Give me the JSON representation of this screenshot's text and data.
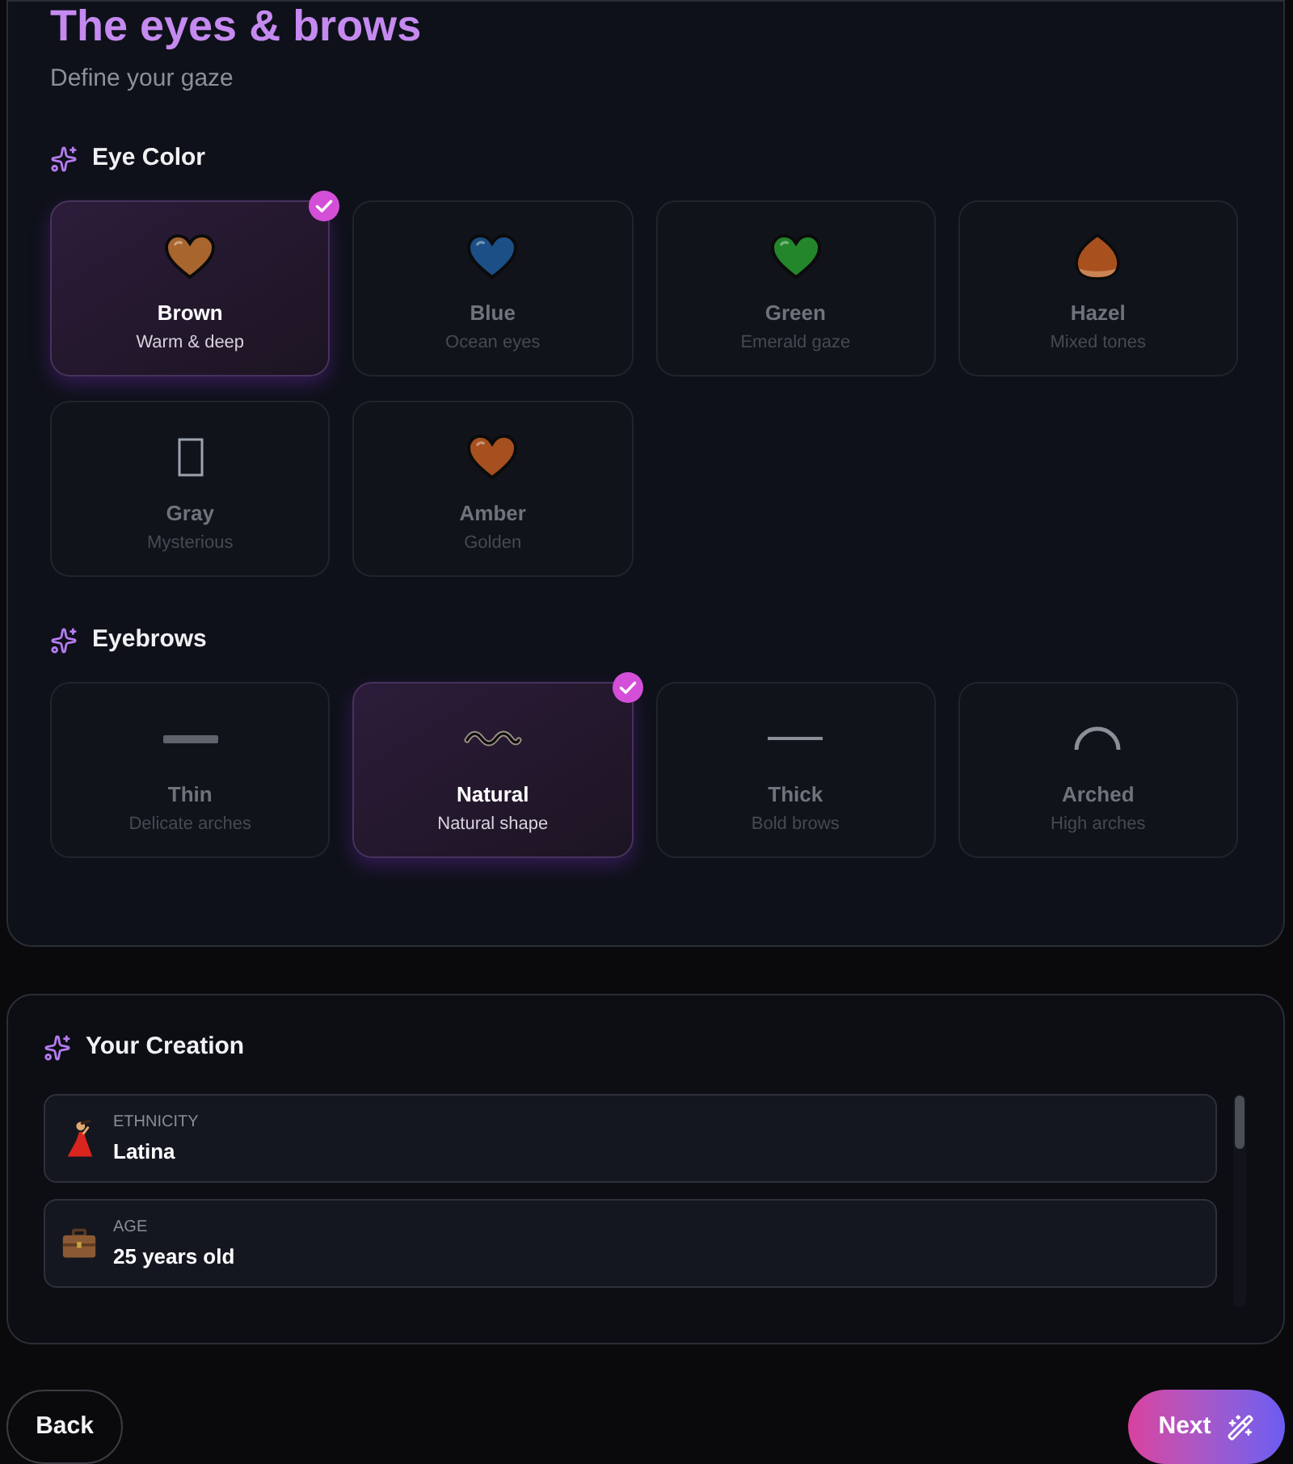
{
  "header": {
    "title": "The eyes & brows",
    "subtitle": "Define your gaze"
  },
  "sections": [
    {
      "heading": "Eye Color",
      "options": [
        {
          "kind": "heart",
          "label": "Brown",
          "caption": "Warm & deep",
          "color": "#a8652e",
          "selected": true
        },
        {
          "kind": "heart",
          "label": "Blue",
          "caption": "Ocean eyes",
          "color": "#1b4f86",
          "selected": false
        },
        {
          "kind": "heart",
          "label": "Green",
          "caption": "Emerald gaze",
          "color": "#23862a",
          "selected": false
        },
        {
          "kind": "chestnut",
          "label": "Hazel",
          "caption": "Mixed tones",
          "color": "#a9501f",
          "selected": false
        },
        {
          "kind": "missing-glyph",
          "label": "Gray",
          "caption": "Mysterious",
          "color": "#9ca3af",
          "selected": false
        },
        {
          "kind": "heart",
          "label": "Amber",
          "caption": "Golden",
          "color": "#a64f1f",
          "selected": false
        }
      ]
    },
    {
      "heading": "Eyebrows",
      "options": [
        {
          "kind": "bar",
          "label": "Thin",
          "caption": "Delicate arches",
          "selected": false
        },
        {
          "kind": "wave",
          "label": "Natural",
          "caption": "Natural shape",
          "selected": true
        },
        {
          "kind": "line",
          "label": "Thick",
          "caption": "Bold brows",
          "selected": false
        },
        {
          "kind": "arc",
          "label": "Arched",
          "caption": "High arches",
          "selected": false
        }
      ]
    }
  ],
  "creation": {
    "heading": "Your Creation",
    "items": [
      {
        "kind": "dancer",
        "label": "ETHNICITY",
        "value": "Latina"
      },
      {
        "kind": "briefcase",
        "label": "AGE",
        "value": "25 years old"
      }
    ]
  },
  "buttons": {
    "back": "Back",
    "next": "Next"
  }
}
